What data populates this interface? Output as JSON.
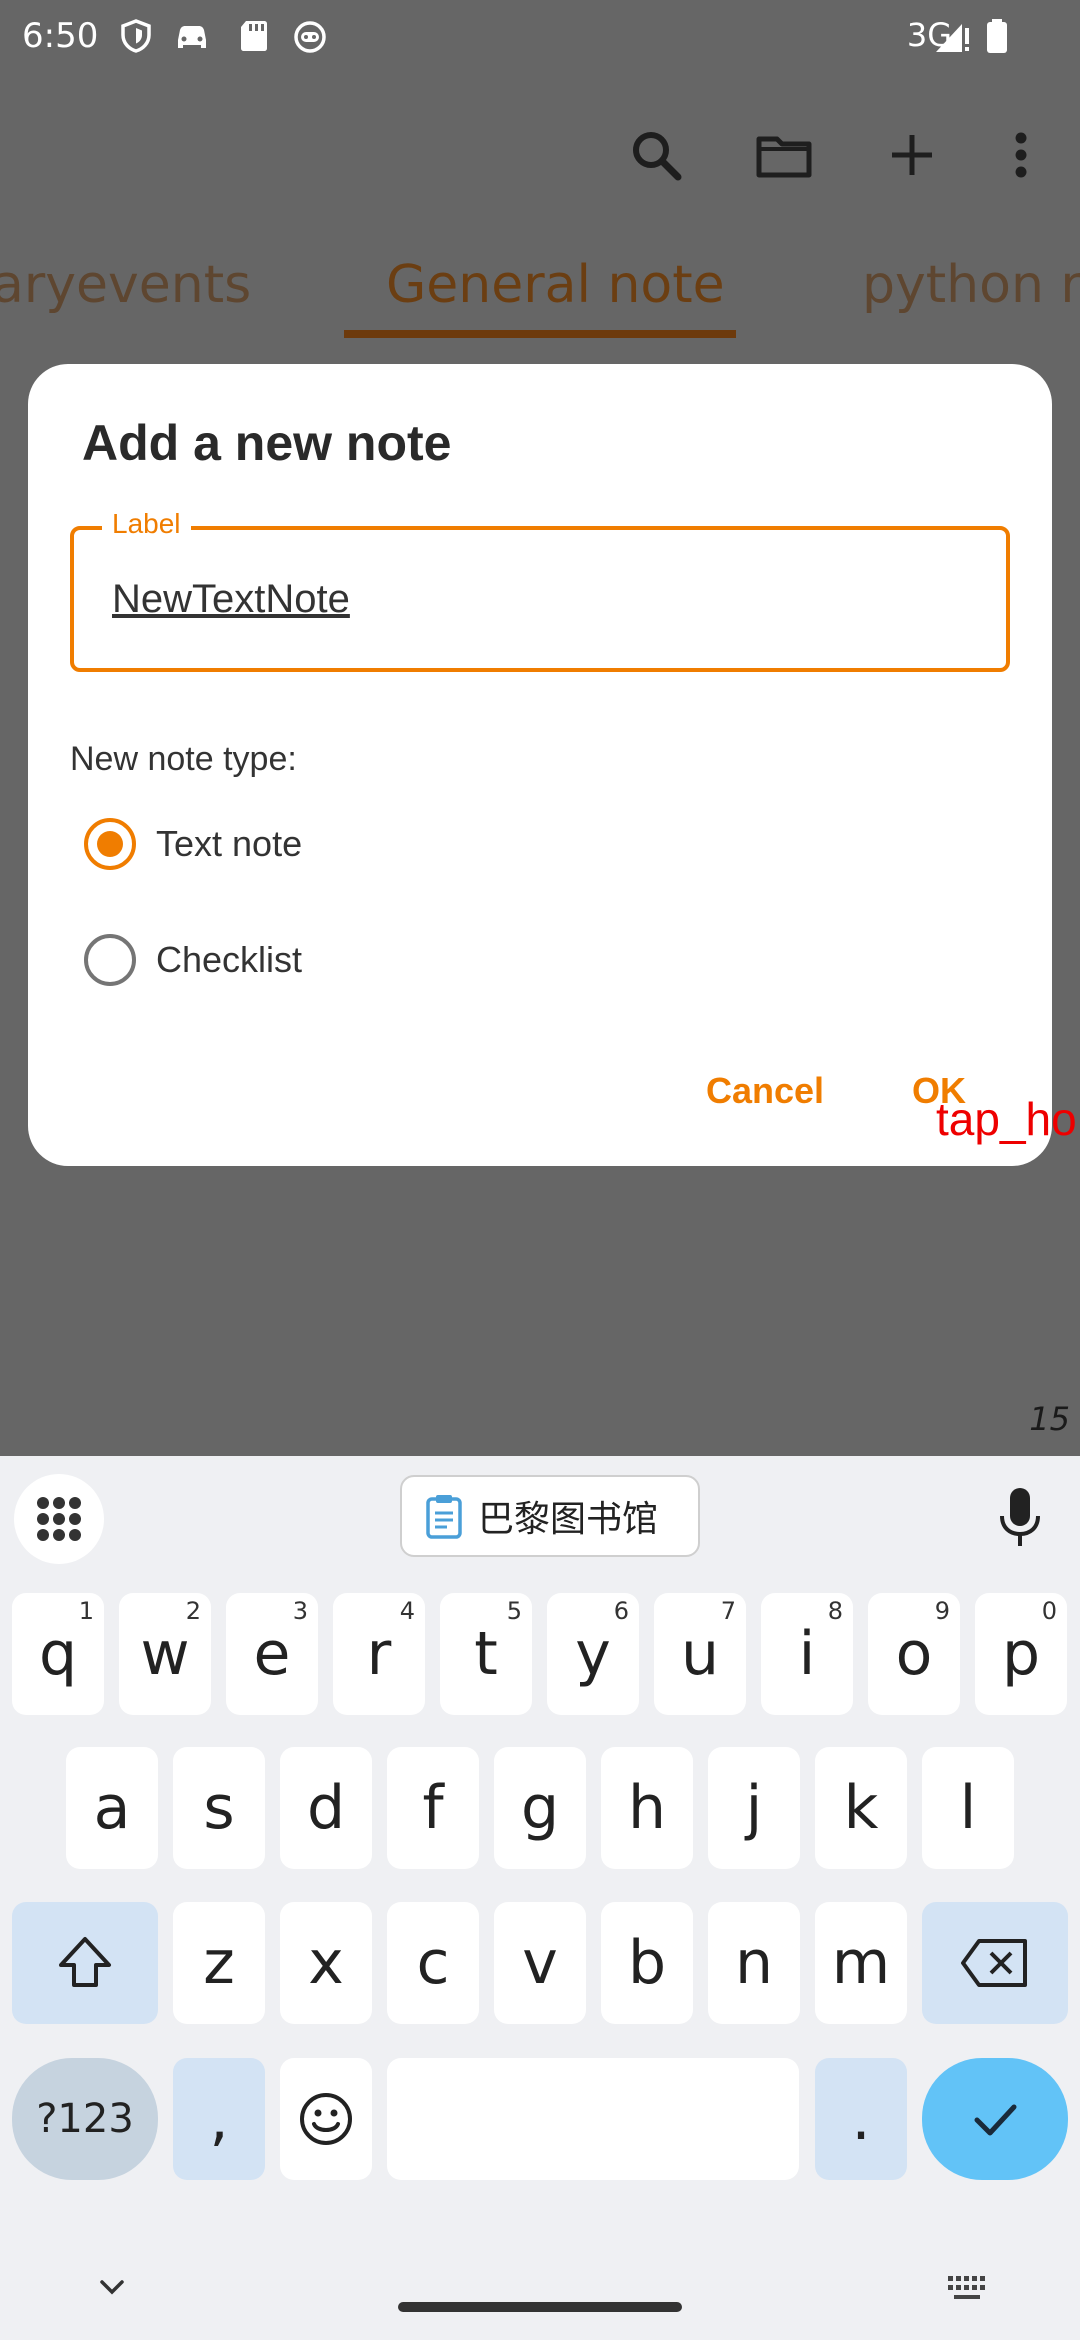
{
  "status_bar": {
    "time": "6:50",
    "network": "3G"
  },
  "tabs": [
    "aryevents",
    "General note",
    "python ru"
  ],
  "page_number": "15",
  "dialog": {
    "title": "Add a new note",
    "field_label": "Label",
    "field_value": "NewTextNote",
    "type_label": "New note type:",
    "options": [
      "Text note",
      "Checklist"
    ],
    "selected_option": "Text note",
    "cancel_label": "Cancel",
    "ok_label": "OK"
  },
  "overlay_tag": "tap_ho",
  "keyboard": {
    "clipboard_suggestion": "巴黎图书馆",
    "row1": [
      "q",
      "w",
      "e",
      "r",
      "t",
      "y",
      "u",
      "i",
      "o",
      "p"
    ],
    "row1_hints": [
      "1",
      "2",
      "3",
      "4",
      "5",
      "6",
      "7",
      "8",
      "9",
      "0"
    ],
    "row2": [
      "a",
      "s",
      "d",
      "f",
      "g",
      "h",
      "j",
      "k",
      "l"
    ],
    "row3": [
      "z",
      "x",
      "c",
      "v",
      "b",
      "n",
      "m"
    ],
    "symbols_label": "?123",
    "comma": ",",
    "period": "."
  },
  "colors": {
    "accent": "#f07d00",
    "scrim": "#666666",
    "enter_key": "#62c3f7"
  }
}
